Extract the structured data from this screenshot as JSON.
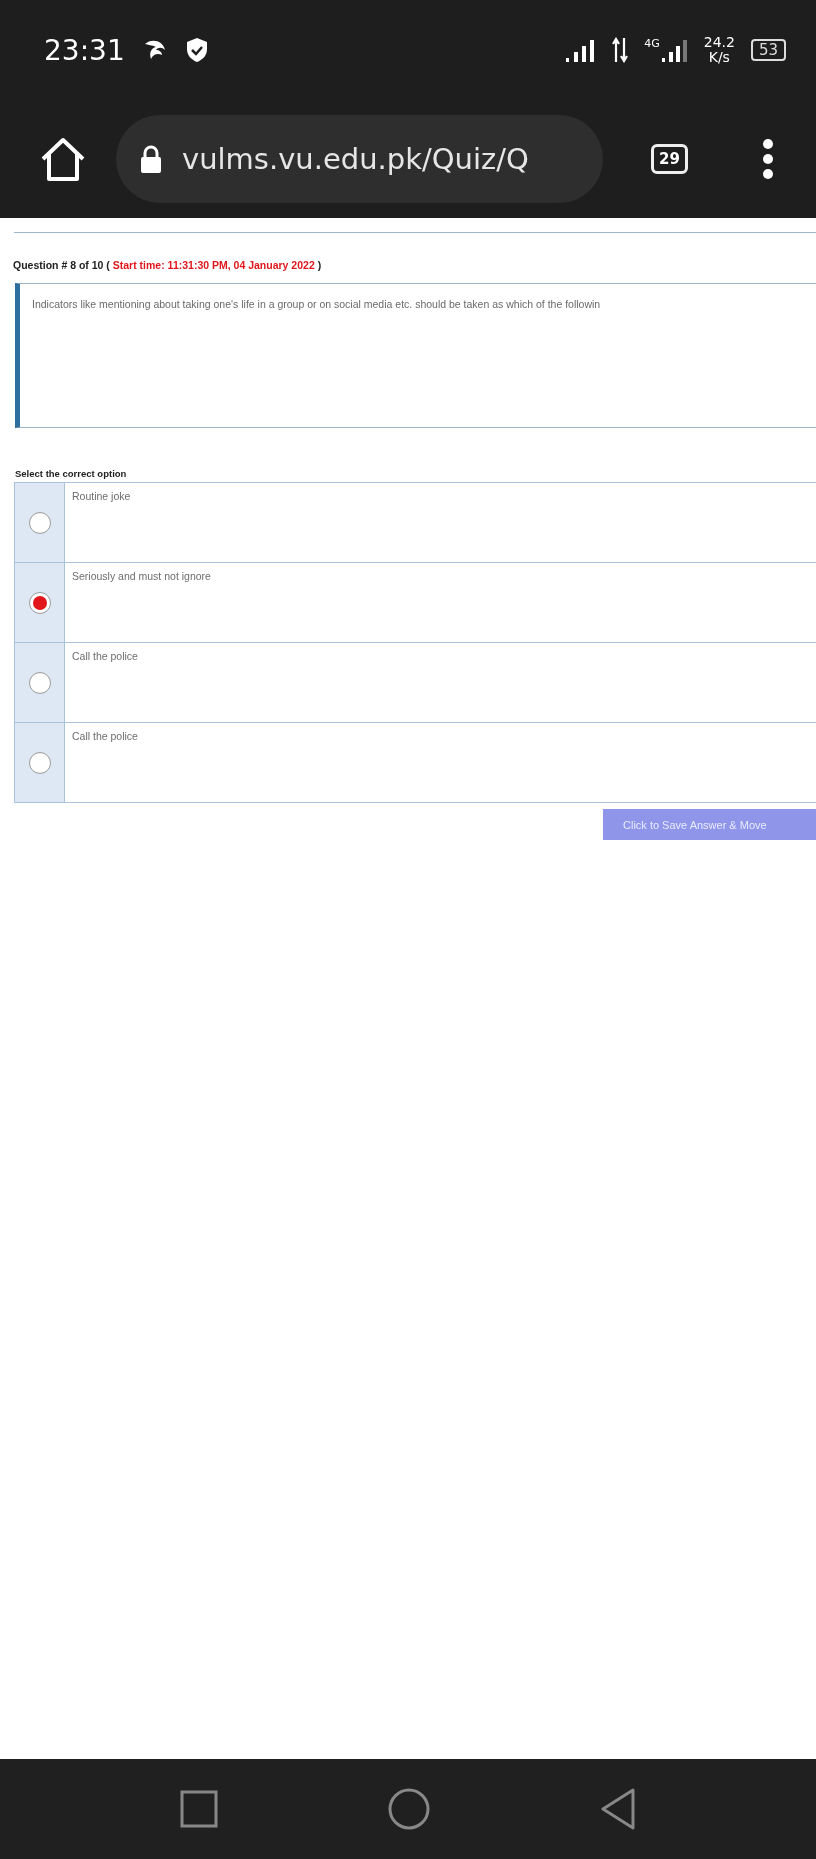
{
  "status_bar": {
    "time": "23:31",
    "network": "4G",
    "speed_value": "24.2",
    "speed_unit": "K/s",
    "battery": "53"
  },
  "browser": {
    "url": "vulms.vu.edu.pk/Quiz/Q",
    "tab_count": "29"
  },
  "quiz": {
    "heading": {
      "label": "Question # 8 of 10",
      "open": "(",
      "start_time": "Start time: 11:31:30 PM, 04 January 2022",
      "close": ")"
    },
    "question": "Indicators like mentioning about taking one's life in a group or on social media etc. should be taken as which of the followin",
    "prompt": "Select the correct option",
    "options": [
      {
        "text": "Routine joke",
        "selected": false
      },
      {
        "text": "Seriously and must not ignore",
        "selected": true
      },
      {
        "text": "Call the police",
        "selected": false
      },
      {
        "text": "Call the police",
        "selected": false
      }
    ],
    "submit": "Click to Save Answer & Move"
  }
}
